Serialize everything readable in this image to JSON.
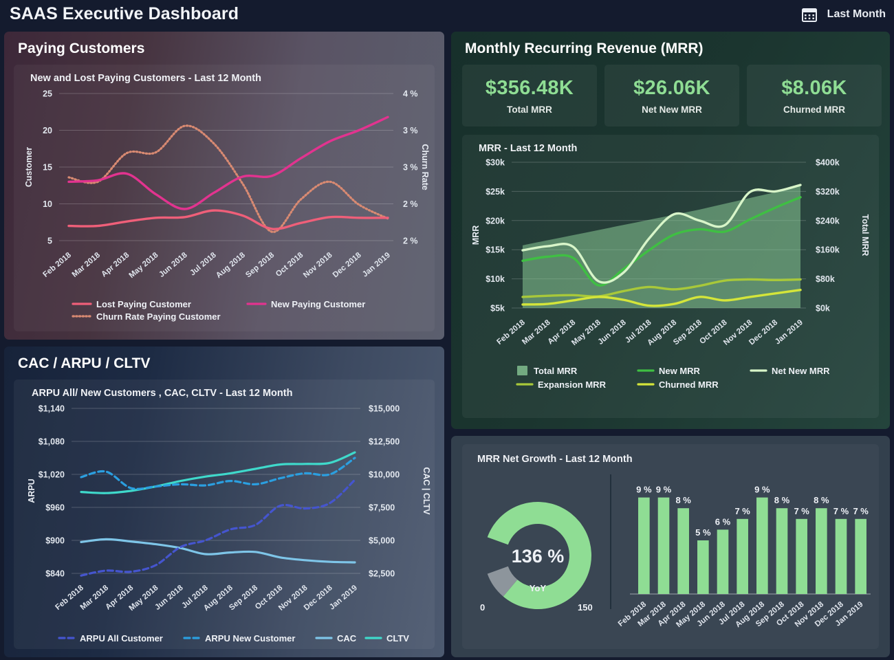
{
  "header": {
    "title": "SAAS Executive Dashboard",
    "date_range_label": "Last Month",
    "calendar_icon": "calendar-icon"
  },
  "panels": {
    "paying_customers": {
      "title": "Paying Customers"
    },
    "cac_arpu_cltv": {
      "title": "CAC / ARPU / CLTV"
    },
    "mrr": {
      "title": "Monthly Recurring Revenue (MRR)"
    }
  },
  "kpis": [
    {
      "value": "$356.48K",
      "label": "Total MRR"
    },
    {
      "value": "$26.06K",
      "label": "Net New MRR"
    },
    {
      "value": "$8.06K",
      "label": "Churned MRR"
    }
  ],
  "colors": {
    "accent_green": "#8fdd94",
    "new_paying_customer": "#e2338f",
    "lost_paying_customer": "#ef5f79",
    "churn_rate": "#d98a72",
    "total_mrr_area": "#8ecf9a",
    "new_mrr": "#3fbf43",
    "net_new_mrr": "#d8f5c9",
    "expansion_mrr": "#a8c83a",
    "churned_mrr": "#d4e53a",
    "arpu_all": "#4555cf",
    "arpu_new": "#2b9fe0",
    "cac": "#7ec5e8",
    "cltv": "#3fd9cb",
    "bar_green": "#8fdd94"
  },
  "chart_data": [
    {
      "id": "new-lost-paying-customers",
      "type": "line",
      "title": "New and Lost Paying Customers - Last 12 Month",
      "xlabel": "",
      "ylabel": "Customer",
      "y2label": "Churn Rate",
      "categories": [
        "Feb 2018",
        "Mar 2018",
        "Apr 2018",
        "May 2018",
        "Jun 2018",
        "Jul 2018",
        "Aug 2018",
        "Sep 2018",
        "Oct 2018",
        "Nov 2018",
        "Dec 2018",
        "Jan 2019"
      ],
      "yticks": [
        "25",
        "20",
        "15",
        "10",
        "5"
      ],
      "ylim": [
        5,
        25
      ],
      "y2ticks": [
        "4 %",
        "3 %",
        "3 %",
        "2 %",
        "2 %"
      ],
      "grid": true,
      "legend_position": "bottom",
      "series": [
        {
          "name": "New Paying Customer",
          "color": "#e2338f",
          "style": "solid",
          "axis": "left",
          "values": [
            13.0,
            13.2,
            14.1,
            11.3,
            9.3,
            11.5,
            13.7,
            13.8,
            16.2,
            18.5,
            20.0,
            21.8
          ]
        },
        {
          "name": "Lost Paying Customer",
          "color": "#ef5f79",
          "style": "solid",
          "axis": "left",
          "values": [
            7.0,
            7.0,
            7.6,
            8.1,
            8.2,
            9.1,
            8.4,
            6.6,
            7.4,
            8.2,
            8.1,
            8.1
          ]
        },
        {
          "name": "Churn Rate Paying Customer",
          "color": "#d98a72",
          "style": "dotted",
          "axis": "left",
          "values": [
            13.6,
            13.0,
            16.9,
            17.0,
            20.6,
            18.2,
            12.7,
            6.2,
            10.6,
            13.0,
            9.9,
            8.0
          ]
        }
      ]
    },
    {
      "id": "mrr-last-12-month",
      "type": "area-line",
      "title": "MRR - Last 12 Month",
      "ylabel": "MRR",
      "y2label": "Total MRR",
      "categories": [
        "Feb 2018",
        "Mar 2018",
        "Apr 2018",
        "May 2018",
        "Jun 2018",
        "Jul 2018",
        "Aug 2018",
        "Sep 2018",
        "Oct 2018",
        "Nov 2018",
        "Dec 2018",
        "Jan 2019"
      ],
      "yticks": [
        "$30k",
        "$25k",
        "$20k",
        "$15k",
        "$10k",
        "$5k"
      ],
      "ylim": [
        5000,
        30000
      ],
      "y2ticks": [
        "$400k",
        "$320k",
        "$240k",
        "$160k",
        "$80k",
        "$0k"
      ],
      "y2lim": [
        0,
        400000
      ],
      "grid": true,
      "legend_position": "bottom",
      "series": [
        {
          "name": "Total MRR",
          "color": "#8ecf9a",
          "style": "area",
          "axis": "right",
          "values": [
            172000,
            186000,
            200000,
            214000,
            228000,
            242000,
            256000,
            270000,
            286000,
            302000,
            318000,
            338000
          ]
        },
        {
          "name": "Net New MRR",
          "color": "#d8f5c9",
          "style": "solid",
          "axis": "left",
          "values": [
            14900,
            15600,
            15500,
            9600,
            11100,
            16900,
            21100,
            20000,
            19200,
            24900,
            25000,
            26100
          ]
        },
        {
          "name": "New MRR",
          "color": "#3fbf43",
          "style": "solid",
          "axis": "left",
          "values": [
            13100,
            13800,
            13600,
            8900,
            11700,
            14900,
            17600,
            18500,
            18100,
            20200,
            22200,
            24000
          ]
        },
        {
          "name": "Expansion MRR",
          "color": "#a8c83a",
          "style": "solid",
          "axis": "left",
          "values": [
            6900,
            7100,
            7200,
            7000,
            7900,
            8600,
            8200,
            8800,
            9700,
            9900,
            9800,
            9900
          ]
        },
        {
          "name": "Churned MRR",
          "color": "#d4e53a",
          "style": "solid",
          "axis": "left",
          "values": [
            5600,
            5700,
            6300,
            6900,
            6400,
            5400,
            5700,
            6900,
            6300,
            6900,
            7500,
            8100
          ]
        }
      ]
    },
    {
      "id": "arpu-cac-cltv",
      "type": "line",
      "title": "ARPU All/ New Customers , CAC, CLTV - Last 12 Month",
      "ylabel": "ARPU",
      "y2label": "CAC | CLTV",
      "categories": [
        "Feb 2018",
        "Mar 2018",
        "Apr 2018",
        "May 2018",
        "Jun 2018",
        "Jul 2018",
        "Aug 2018",
        "Sep 2018",
        "Oct 2018",
        "Nov 2018",
        "Dec 2018",
        "Jan 2019"
      ],
      "yticks": [
        "$1,140",
        "$1,080",
        "$1,020",
        "$960",
        "$900",
        "$840"
      ],
      "ylim": [
        840,
        1140
      ],
      "y2ticks": [
        "$15,000",
        "$12,500",
        "$10,000",
        "$7,500",
        "$5,000",
        "$2,500"
      ],
      "y2lim": [
        2500,
        15000
      ],
      "grid": true,
      "legend_position": "bottom",
      "series": [
        {
          "name": "ARPU All Customer",
          "color": "#4555cf",
          "style": "dashed",
          "axis": "left",
          "values": [
            836,
            845,
            843,
            855,
            888,
            900,
            920,
            928,
            963,
            958,
            968,
            1010
          ]
        },
        {
          "name": "ARPU New Customer",
          "color": "#2b9fe0",
          "style": "dashed",
          "axis": "left",
          "values": [
            1015,
            1025,
            995,
            998,
            1002,
            1000,
            1008,
            1002,
            1013,
            1022,
            1020,
            1050
          ]
        },
        {
          "name": "CAC",
          "color": "#7ec5e8",
          "style": "solid",
          "axis": "left",
          "values": [
            897,
            902,
            898,
            893,
            886,
            875,
            878,
            879,
            869,
            864,
            861,
            860
          ]
        },
        {
          "name": "CLTV",
          "color": "#3fd9cb",
          "style": "solid",
          "axis": "left",
          "values": [
            988,
            986,
            990,
            998,
            1008,
            1016,
            1022,
            1030,
            1038,
            1039,
            1041,
            1060
          ]
        }
      ]
    },
    {
      "id": "mrr-net-growth-gauge",
      "type": "gauge",
      "title": "MRR Net Growth - Last 12 Month",
      "value": 136,
      "value_label": "136 %",
      "sub_label": "YoY",
      "min": 0,
      "max": 150,
      "min_label": "0",
      "max_label": "150",
      "color": "#8fdd94"
    },
    {
      "id": "mrr-net-growth-bars",
      "type": "bar",
      "title": "",
      "categories": [
        "Feb 2018",
        "Mar 2018",
        "Apr 2018",
        "May 2018",
        "Jun 2018",
        "Jul 2018",
        "Aug 2018",
        "Sep 2018",
        "Oct 2018",
        "Nov 2018",
        "Dec 2018",
        "Jan 2019"
      ],
      "values": [
        9,
        9,
        8,
        5,
        6,
        7,
        9,
        8,
        7,
        8,
        7,
        7
      ],
      "labels": [
        "9 %",
        "9 %",
        "8 %",
        "5 %",
        "6 %",
        "7 %",
        "9 %",
        "8 %",
        "7 %",
        "8 %",
        "7 %",
        "7 %"
      ],
      "ylim": [
        0,
        10
      ],
      "color": "#8fdd94",
      "grid": false
    }
  ]
}
